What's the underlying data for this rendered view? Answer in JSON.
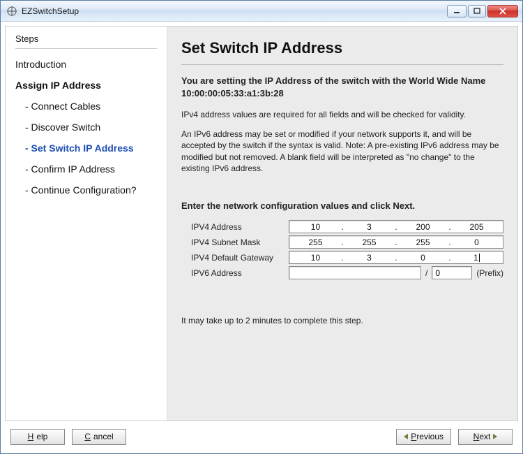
{
  "window": {
    "title": "EZSwitchSetup"
  },
  "sidebar": {
    "header": "Steps",
    "step_intro": "Introduction",
    "step_assign": "Assign IP Address",
    "sub_connect": "- Connect Cables",
    "sub_discover": "- Discover Switch",
    "sub_setip": "- Set Switch IP Address",
    "sub_confirm": "- Confirm IP Address",
    "sub_continue": "- Continue Configuration?"
  },
  "main": {
    "title": "Set Switch IP Address",
    "lead": "You are setting the IP Address of the switch with the World Wide Name 10:00:00:05:33:a1:3b:28",
    "p1": "IPv4 address values are required for all fields and will be checked for validity.",
    "p2": "An IPv6 address may be set or modified if your network supports it, and will be accepted by the switch if the syntax is valid. Note: A pre-existing IPv6 address may be modified but not removed. A blank field will be interpreted as \"no change\" to the existing IPv6 address.",
    "section": "Enter the network configuration values and click Next.",
    "labels": {
      "ipv4addr": "IPV4 Address",
      "ipv4mask": "IPV4 Subnet Mask",
      "ipv4gw": "IPV4 Default Gateway",
      "ipv6": "IPV6 Address",
      "prefix": "(Prefix)",
      "slash": "/"
    },
    "values": {
      "ipv4addr": {
        "o1": "10",
        "o2": "3",
        "o3": "200",
        "o4": "205"
      },
      "ipv4mask": {
        "o1": "255",
        "o2": "255",
        "o3": "255",
        "o4": "0"
      },
      "ipv4gw": {
        "o1": "10",
        "o2": "3",
        "o3": "0",
        "o4": "1"
      },
      "ipv6": "",
      "prefix": "0"
    },
    "note": "It may take up to 2 minutes to complete this step."
  },
  "footer": {
    "help": "Help",
    "cancel": "Cancel",
    "previous": "Previous",
    "next": "Next"
  }
}
